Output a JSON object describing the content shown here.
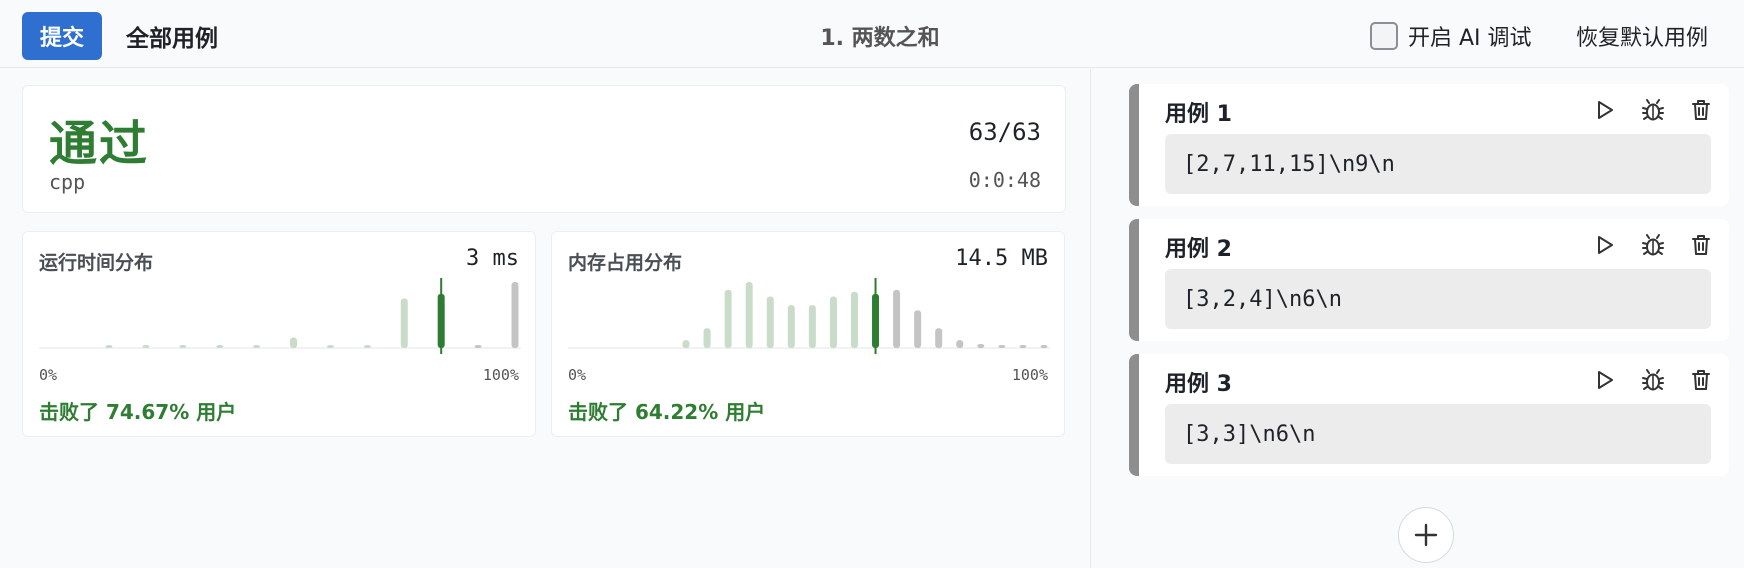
{
  "header": {
    "submit_label": "提交",
    "all_cases_label": "全部用例",
    "problem_title": "1. 两数之和",
    "ai_debug_label": "开启 AI 调试",
    "reset_label": "恢复默认用例"
  },
  "result": {
    "status": "通过",
    "language": "cpp",
    "passed": "63/63",
    "elapsed": "0:0:48"
  },
  "runtime": {
    "title": "运行时间分布",
    "value": "3 ms",
    "axis_min": "0%",
    "axis_max": "100%",
    "beat_text": "击败了 74.67% 用户",
    "bars": [
      0.04,
      0.04,
      0.04,
      0.04,
      0.04,
      0.16,
      0.04,
      0.04,
      0.75,
      0.82,
      0.04,
      1.0
    ],
    "bar_states": [
      "light",
      "light",
      "light",
      "light",
      "light",
      "light",
      "light",
      "light",
      "light",
      "current",
      "gray",
      "gray"
    ]
  },
  "memory": {
    "title": "内存占用分布",
    "value": "14.5 MB",
    "axis_min": "0%",
    "axis_max": "100%",
    "beat_text": "击败了 64.22% 用户",
    "bars": [
      0.12,
      0.3,
      0.88,
      1.0,
      0.78,
      0.65,
      0.65,
      0.78,
      0.85,
      0.82,
      0.88,
      0.57,
      0.3,
      0.12,
      0.06,
      0.04,
      0.04,
      0.04
    ],
    "bar_states": [
      "light",
      "light",
      "light",
      "light",
      "light",
      "light",
      "light",
      "light",
      "light",
      "current",
      "gray",
      "gray",
      "gray",
      "gray",
      "gray",
      "gray",
      "gray",
      "gray"
    ]
  },
  "cases": [
    {
      "title": "用例 1",
      "input": "[2,7,11,15]\\n9\\n"
    },
    {
      "title": "用例 2",
      "input": "[3,2,4]\\n6\\n"
    },
    {
      "title": "用例 3",
      "input": "[3,3]\\n6\\n"
    }
  ],
  "icons": {
    "run": "play-icon",
    "debug": "bug-icon",
    "delete": "trash-icon",
    "add": "plus-icon"
  },
  "colors": {
    "primary": "#2f6fd0",
    "success": "#2e7d32",
    "bar_light": "#c9dcc9",
    "bar_current": "#2e7d32",
    "bar_gray": "#c4c4c4",
    "case_border": "#8e8e8e"
  }
}
